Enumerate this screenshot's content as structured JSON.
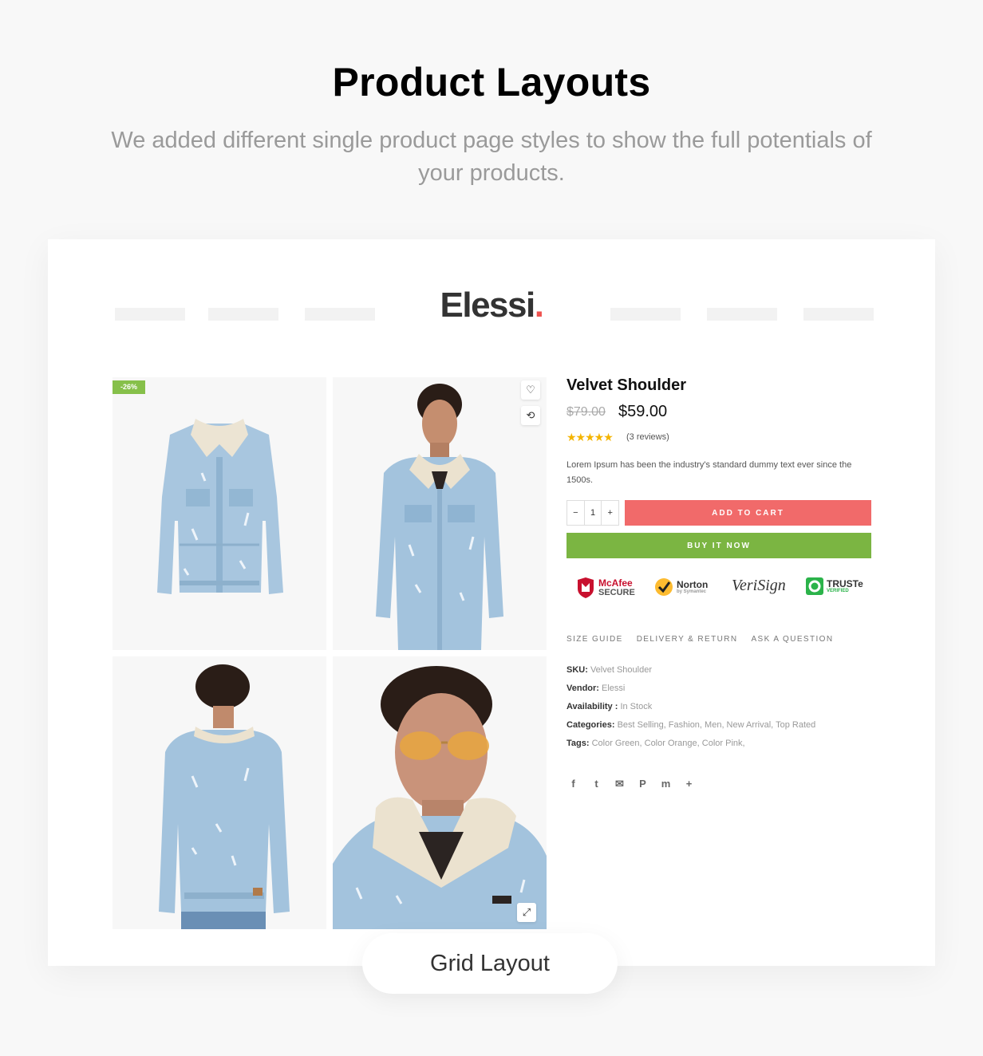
{
  "hero": {
    "title": "Product Layouts",
    "subtitle": "We added different single product page styles to show the full potentials of your products."
  },
  "store": {
    "logo": "Elessi",
    "logo_dot": "."
  },
  "gallery": {
    "badge": "-26%",
    "icons": [
      "heart-icon",
      "compare-icon",
      "expand-icon"
    ]
  },
  "product": {
    "title": "Velvet Shoulder",
    "old_price": "$79.00",
    "price": "$59.00",
    "stars": "★★★★★",
    "rating": 4.5,
    "reviews": "(3 reviews)",
    "description": "Lorem Ipsum has been the industry's standard dummy text ever since the 1500s.",
    "qty_minus": "−",
    "qty_value": "1",
    "qty_plus": "+",
    "add_to_cart": "ADD TO CART",
    "buy_now": "BUY IT NOW"
  },
  "trust_badges": [
    {
      "line1": "McAfee",
      "line2": "SECURE"
    },
    {
      "line1": "Norton",
      "line2": "by Symantec"
    },
    {
      "line1": "VeriSign"
    },
    {
      "line1": "TRUSTe",
      "line2": "VERIFIED"
    }
  ],
  "tabs": [
    "SIZE GUIDE",
    "DELIVERY & RETURN",
    "ASK A QUESTION"
  ],
  "meta": {
    "sku_label": "SKU:",
    "sku": "Velvet Shoulder",
    "vendor_label": "Vendor:",
    "vendor": "Elessi",
    "availability_label": "Availability :",
    "availability": "In Stock",
    "categories_label": "Categories:",
    "categories": "Best Selling, Fashion, Men, New Arrival, Top Rated",
    "tags_label": "Tags:",
    "tags": "Color Green, Color Orange, Color Pink,"
  },
  "social": {
    "facebook": "f",
    "twitter": "t",
    "email": "✉",
    "pinterest": "P",
    "messenger": "m",
    "more": "+"
  },
  "layout_label": "Grid Layout",
  "colors": {
    "accent_red": "#f16a6a",
    "accent_green": "#7bb542",
    "badge_green": "#86c04a",
    "star": "#f4b400",
    "denim": "#9cc1dc"
  }
}
